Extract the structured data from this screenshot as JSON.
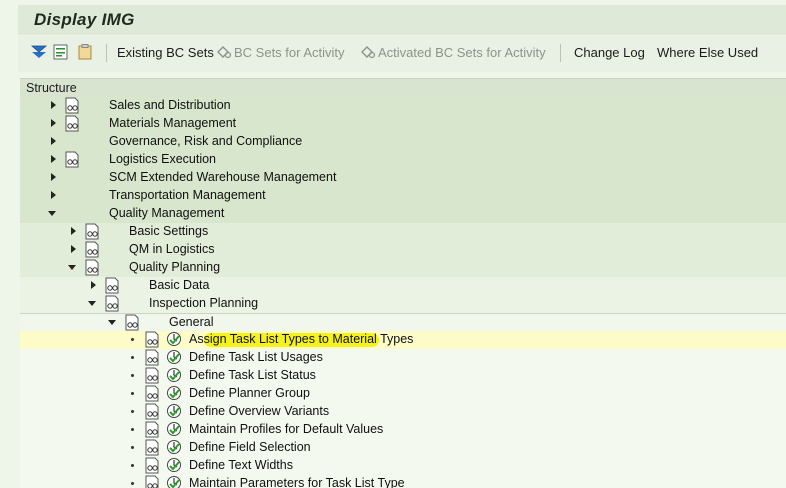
{
  "window": {
    "title": "Display IMG"
  },
  "toolbar": {
    "existing_bc_sets": "Existing BC Sets",
    "bc_sets_for_activity": "BC Sets for Activity",
    "activated_bc_sets_for_activity": "Activated BC Sets for Activity",
    "change_log": "Change Log",
    "where_else_used": "Where Else Used"
  },
  "structure": {
    "header": "Structure",
    "nodes": [
      {
        "label": "Sales and Distribution"
      },
      {
        "label": "Materials Management"
      },
      {
        "label": "Governance, Risk and Compliance"
      },
      {
        "label": "Logistics Execution"
      },
      {
        "label": "SCM Extended Warehouse Management"
      },
      {
        "label": "Transportation Management"
      },
      {
        "label": "Quality Management"
      },
      {
        "label": "Basic Settings"
      },
      {
        "label": "QM in Logistics"
      },
      {
        "label": "Quality Planning"
      },
      {
        "label": "Basic Data"
      },
      {
        "label": "Inspection Planning"
      },
      {
        "label": "General"
      },
      {
        "label": "Assign Task List Types to Material Types"
      },
      {
        "label": "Define Task List Usages"
      },
      {
        "label": "Define Task List Status"
      },
      {
        "label": "Define Planner Group"
      },
      {
        "label": "Define Overview Variants"
      },
      {
        "label": "Maintain Profiles for Default Values"
      },
      {
        "label": "Define Field Selection"
      },
      {
        "label": "Define Text Widths"
      },
      {
        "label": "Maintain Parameters for Task List Type"
      }
    ]
  },
  "colors": {
    "highlight": "#f3f000",
    "selected_row": "#fdfcc8"
  }
}
